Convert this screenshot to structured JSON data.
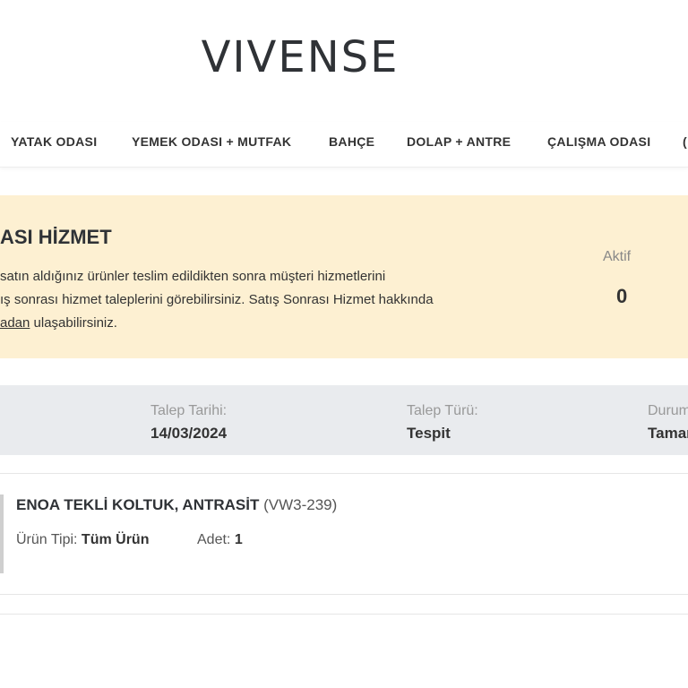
{
  "brand": {
    "logo_text": "VIVENSE"
  },
  "nav": {
    "items": [
      {
        "label": "YATAK ODASI"
      },
      {
        "label": "YEMEK ODASI + MUTFAK"
      },
      {
        "label": "BAHÇE"
      },
      {
        "label": "DOLAP + ANTRE"
      },
      {
        "label": "ÇALIŞMA ODASI"
      },
      {
        "label": "("
      }
    ]
  },
  "info": {
    "title": "ASI HİZMET",
    "line1": "satın aldığınız ürünler teslim edildikten sonra müşteri hizmetlerini",
    "line2": "ış sonrası hizmet taleplerini görebilirsiniz. Satış Sonrası Hizmet hakkında",
    "line3_link": "adan",
    "line3_rest": " ulaşabilirsiniz.",
    "stat_label": "Aktif",
    "stat_value": "0"
  },
  "request": {
    "date_label": "Talep Tarihi:",
    "date_value": "14/03/2024",
    "type_label": "Talep Türü:",
    "type_value": "Tespit",
    "status_label": "Durum",
    "status_value": "Tamar"
  },
  "product": {
    "name": "ENOA TEKLİ KOLTUK, ANTRASİT",
    "code": "(VW3-239)",
    "type_label": "Ürün Tipi:",
    "type_value": "Tüm Ürün",
    "qty_label": "Adet:",
    "qty_value": "1"
  }
}
